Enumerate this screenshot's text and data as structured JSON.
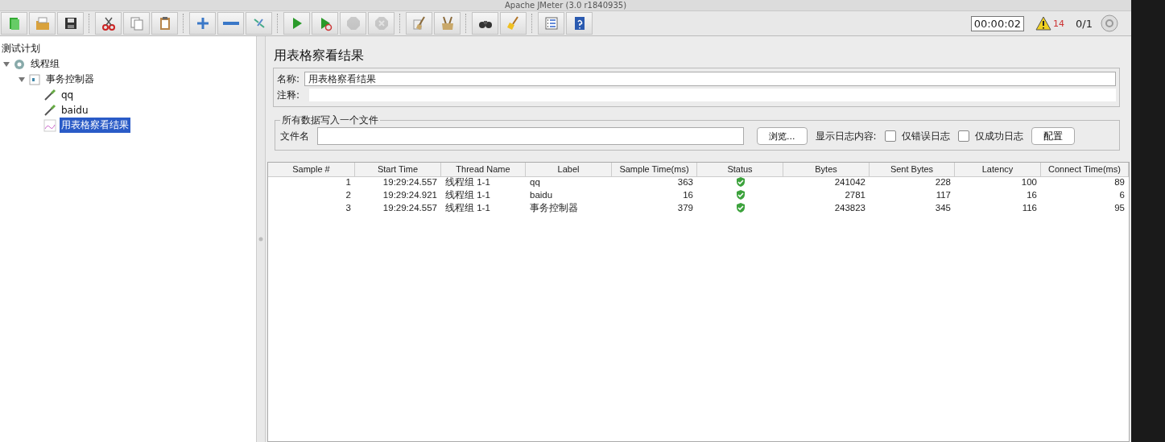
{
  "window": {
    "title": "Apache JMeter (3.0 r1840935)"
  },
  "toolbar": {
    "buttons": [
      {
        "disabled": false
      },
      {
        "disabled": false
      },
      {
        "disabled": false
      },
      {
        "disabled": false
      },
      {
        "disabled": false
      },
      {
        "disabled": false
      },
      {
        "disabled": false
      },
      {
        "disabled": false
      },
      {
        "disabled": false
      },
      {
        "disabled": false
      },
      {
        "disabled": false
      },
      {
        "disabled": true
      },
      {
        "disabled": true
      },
      {
        "disabled": false
      },
      {
        "disabled": false
      },
      {
        "disabled": false
      },
      {
        "disabled": false
      },
      {
        "disabled": false
      },
      {
        "disabled": false
      }
    ],
    "timer": "00:00:02",
    "warning_count": "14",
    "threads": "0/1"
  },
  "tree": [
    {
      "label": "测试计划",
      "selected": false,
      "children": [
        {
          "label": "线程组",
          "kind": "threads",
          "selected": false,
          "expanded": true,
          "children": [
            {
              "label": "事务控制器",
              "kind": "controller",
              "selected": false,
              "expanded": true,
              "children": [
                {
                  "label": "qq",
                  "kind": "sampler",
                  "selected": false
                },
                {
                  "label": "baidu",
                  "kind": "sampler",
                  "selected": false
                },
                {
                  "label": "用表格察看结果",
                  "kind": "listener",
                  "selected": true
                }
              ]
            }
          ]
        }
      ]
    }
  ],
  "panel": {
    "title": "用表格察看结果",
    "name_label": "名称:",
    "name_value": "用表格察看结果",
    "comment_label": "注释:",
    "file_group": {
      "legend": "所有数据写入一个文件",
      "file_label": "文件名",
      "browse": "浏览...",
      "log_label": "显示日志内容:",
      "checkboxes": [
        {
          "label": "仅错误日志",
          "checked": false
        },
        {
          "label": "仅成功日志",
          "checked": false
        }
      ],
      "configure": "配置"
    }
  },
  "table": {
    "columns": [
      "Sample #",
      "Start Time",
      "Thread Name",
      "Label",
      "Sample Time(ms)",
      "Status",
      "Bytes",
      "Sent Bytes",
      "Latency",
      "Connect Time(ms)"
    ],
    "rows": [
      {
        "cells": [
          "1",
          "19:29:24.557",
          "线程组 1-1",
          "qq",
          "363",
          "241042",
          "228",
          "100",
          "89"
        ],
        "success": true
      },
      {
        "cells": [
          "2",
          "19:29:24.921",
          "线程组 1-1",
          "baidu",
          "16",
          "2781",
          "117",
          "16",
          "6"
        ],
        "success": true
      },
      {
        "cells": [
          "3",
          "19:29:24.557",
          "线程组 1-1",
          "事务控制器",
          "379",
          "243823",
          "345",
          "116",
          "95"
        ],
        "success": true
      }
    ]
  }
}
